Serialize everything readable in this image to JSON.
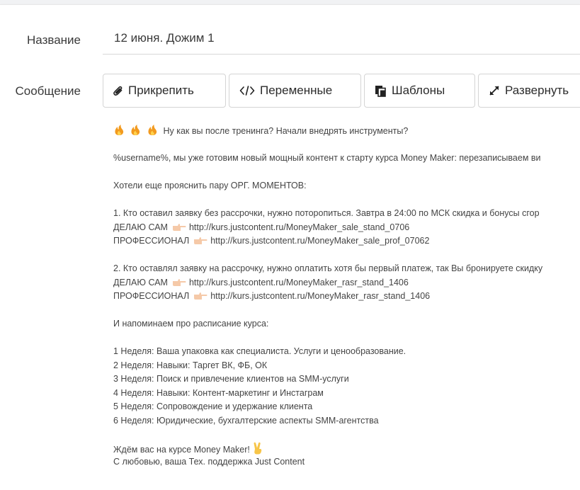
{
  "form": {
    "name_label": "Название",
    "name_value": "12 июня. Дожим 1",
    "message_label": "Сообщение"
  },
  "toolbar": {
    "attach_label": "Прикрепить",
    "variables_label": "Переменные",
    "templates_label": "Шаблоны",
    "expand_label": "Развернуть"
  },
  "message": {
    "intro": "Ну как вы после тренинга? Начали внедрять инструменты?",
    "p1": "%username%, мы уже готовим новый мощный контент к старту курса Money Maker: перезаписываем ви",
    "p2": "Хотели еще прояснить пару ОРГ. МОМЕНТОВ:",
    "p3_l1": "1. Кто оставил заявку без рассрочки, нужно поторопиться. Завтра в 24:00 по МСК скидка и бонусы сгор",
    "p3_l2_label": "ДЕЛАЮ САМ",
    "p3_l2_url": "http://kurs.justcontent.ru/MoneyMaker_sale_stand_0706",
    "p3_l3_label": "ПРОФЕССИОНАЛ",
    "p3_l3_url": "http://kurs.justcontent.ru/MoneyMaker_sale_prof_07062",
    "p4_l1": "2. Кто оставлял заявку на рассрочку, нужно оплатить хотя бы первый платеж, так Вы бронируете скидку",
    "p4_l2_label": "ДЕЛАЮ САМ",
    "p4_l2_url": "http://kurs.justcontent.ru/MoneyMaker_rasr_stand_1406",
    "p4_l3_label": "ПРОФЕССИОНАЛ",
    "p4_l3_url": "http://kurs.justcontent.ru/MoneyMaker_rasr_stand_1406",
    "p5": "И напоминаем про расписание курса:",
    "schedule": [
      "1 Неделя: Ваша упаковка как специалиста. Услуги и ценообразование.",
      "2 Неделя: Навыки: Таргет ВК, ФБ, ОК",
      "3 Неделя: Поиск и привлечение клиентов на SMM-услуги",
      "4 Неделя: Навыки: Контент-маркетинг и Инстаграм",
      "5 Неделя: Сопровождение и удержание клиента",
      "6 Неделя: Юридические, бухгалтерские аспекты SMM-агентства"
    ],
    "outro": "Ждём вас на курсе Money Maker!",
    "signature": "С любовью, ваша Тех. поддержка Just Content"
  },
  "icons": {
    "attach": "paperclip-icon",
    "variables": "code-icon",
    "templates": "copy-icon",
    "expand": "expand-icon",
    "fire": "fire-emoji",
    "pointing_hand": "pointing-right-emoji",
    "victory_hand": "victory-hand-emoji"
  },
  "colors": {
    "text": "#444444",
    "border": "#d4d4d4",
    "fire": "#f29a1e",
    "hand": "#f5c9a8"
  }
}
